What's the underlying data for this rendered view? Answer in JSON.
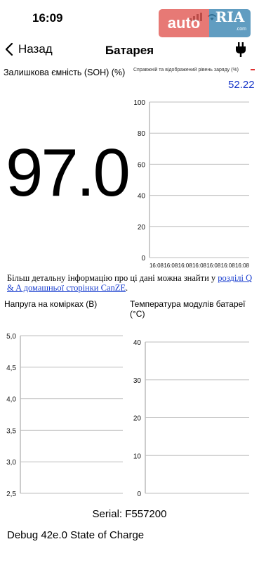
{
  "status_bar": {
    "time": "16:09"
  },
  "watermark": {
    "left": "auto",
    "right": "RIA",
    "domain": ".com"
  },
  "nav": {
    "back_label": "Назад",
    "title": "Батарея"
  },
  "soh": {
    "label": "Залишкова ємність (SOH) (%)",
    "value": "97.0"
  },
  "soc_chart": {
    "title": "Справжній та відображений рівень заряду (%)",
    "current_value": "52.22"
  },
  "info": {
    "text_before": "Більш детальну інформацію про ці дані можна знайти у ",
    "link_text": "розділі Q & A домашньої сторінки CanZE",
    "text_after": "."
  },
  "voltage_chart": {
    "title": "Напруга на комірках (В)"
  },
  "temperature_chart": {
    "title": "Температура модулів батареї (°C)"
  },
  "footer": {
    "serial": "Serial: F557200",
    "debug": "Debug 42e.0 State of Charge"
  },
  "chart_data": [
    {
      "type": "line",
      "title": "Справжній та відображений рівень заряду (%)",
      "ylim": [
        0,
        100
      ],
      "yticks": [
        0,
        20,
        40,
        60,
        80,
        100
      ],
      "xticks": [
        "16:08",
        "16:08",
        "16:08",
        "16:08",
        "16:08",
        "16:08",
        "16:08"
      ],
      "series": [],
      "grid": true
    },
    {
      "type": "line",
      "title": "Напруга на комірках (В)",
      "ylim": [
        2.5,
        5.0
      ],
      "yticks": [
        "2,5",
        "3,0",
        "3,5",
        "4,0",
        "4,5",
        "5,0"
      ],
      "series": [],
      "grid": true
    },
    {
      "type": "line",
      "title": "Температура модулів батареї (°C)",
      "ylim": [
        0,
        40
      ],
      "yticks": [
        "0",
        "10",
        "20",
        "30",
        "40"
      ],
      "series": [],
      "grid": true
    }
  ]
}
